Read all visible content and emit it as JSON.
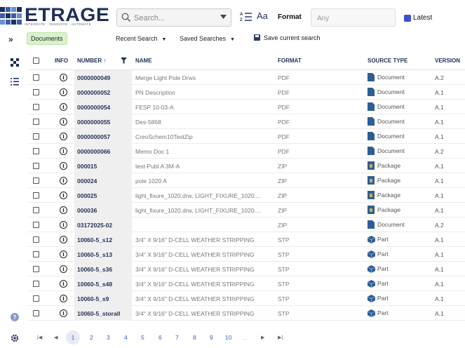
{
  "logo": {
    "name": "ETRAGE",
    "tagline": "INTEGRATE · INNOVATE · AUTOMATE",
    "colors": [
      "#1f2f5a",
      "#3a5ea8",
      "#6a8fd0"
    ]
  },
  "search": {
    "placeholder": "Search...",
    "icon": "search-icon"
  },
  "format_filter": {
    "label": "Format",
    "placeholder": "Any",
    "sort_icon": "sort-az-icon",
    "font_icon": "font-size-icon",
    "font_icon_text": "Aa"
  },
  "latest": {
    "label": "Latest",
    "color": "#3a52d0"
  },
  "toolbar": {
    "expand_icon": "double-chevron-right-icon",
    "documents_label": "Documents",
    "recent_search_label": "Recent Search",
    "saved_searches_label": "Saved Searches",
    "save_current_search_label": "Save current search"
  },
  "rail": {
    "icons": [
      "tree-icon",
      "list-icon",
      "help-icon",
      "settings-icon"
    ]
  },
  "columns": {
    "info": "INFO",
    "number": "NUMBER ↑",
    "name": "NAME",
    "format": "FORMAT",
    "source_type": "SOURCE TYPE",
    "version": "VERSION"
  },
  "rows": [
    {
      "number": "0000000049",
      "name": "Merge Light Pole Drws",
      "format": "PDF",
      "source_type": "Document",
      "source_icon": "document-icon",
      "version": "A.2"
    },
    {
      "number": "0000000052",
      "name": "PN Description",
      "format": "PDF",
      "source_type": "Document",
      "source_icon": "document-icon",
      "version": "A.1"
    },
    {
      "number": "0000000054",
      "name": "FESP 10-03-A",
      "format": "PDF",
      "source_type": "Document",
      "source_icon": "document-icon",
      "version": "A.1"
    },
    {
      "number": "0000000055",
      "name": "Des-5868",
      "format": "PDF",
      "source_type": "Document",
      "source_icon": "document-icon",
      "version": "A.1"
    },
    {
      "number": "0000000057",
      "name": "CreoSchem10TestZip",
      "format": "PDF",
      "source_type": "Document",
      "source_icon": "document-icon",
      "version": "A.1"
    },
    {
      "number": "0000000066",
      "name": "Memo Doc 1",
      "format": "PDF",
      "source_type": "Document",
      "source_icon": "document-icon",
      "version": "A.2"
    },
    {
      "number": "000015",
      "name": "test-Publ A 3M-A",
      "format": "ZIP",
      "source_type": "Package",
      "source_icon": "package-icon",
      "version": "A.1"
    },
    {
      "number": "000024",
      "name": "pole 1020 A",
      "format": "ZIP",
      "source_type": "Package",
      "source_icon": "package-icon",
      "version": "A.1"
    },
    {
      "number": "000025",
      "name": "light_fixure_1020.drw, LIGHT_FIXURE_1020....",
      "format": "ZIP",
      "source_type": "Package",
      "source_icon": "package-icon",
      "version": "A.1"
    },
    {
      "number": "000036",
      "name": "light_fixure_1020.drw, LIGHT_FIXURE_1020....",
      "format": "ZIP",
      "source_type": "Package",
      "source_icon": "package-icon",
      "version": "A.1"
    },
    {
      "number": "03172025-02",
      "name": "",
      "format": "ZIP",
      "source_type": "Document",
      "source_icon": "document-icon",
      "version": "A.2"
    },
    {
      "number": "10060-5_s12",
      "name": "3/4\" X 9/16\" D-CELL WEATHER STRIPPING",
      "format": "STP",
      "source_type": "Part",
      "source_icon": "part-icon",
      "version": "A.1"
    },
    {
      "number": "10060-5_s13",
      "name": "3/4\" X 9/16\" D-CELL WEATHER STRIPPING",
      "format": "STP",
      "source_type": "Part",
      "source_icon": "part-icon",
      "version": "A.1"
    },
    {
      "number": "10060-5_s36",
      "name": "3/4\" X 9/16\" D-CELL WEATHER STRIPPING",
      "format": "STP",
      "source_type": "Part",
      "source_icon": "part-icon",
      "version": "A.1"
    },
    {
      "number": "10060-5_s48",
      "name": "3/4\" X 9/16\" D-CELL WEATHER STRIPPING",
      "format": "STP",
      "source_type": "Part",
      "source_icon": "part-icon",
      "version": "A.1"
    },
    {
      "number": "10060-5_s9",
      "name": "3/4\" X 9/16\" D-CELL WEATHER STRIPPING",
      "format": "STP",
      "source_type": "Part",
      "source_icon": "part-icon",
      "version": "A.1"
    },
    {
      "number": "10060-5_storall",
      "name": "3/4\" X 9/16\" D-CELL WEATHER STRIPPING",
      "format": "STP",
      "source_type": "Part",
      "source_icon": "part-icon",
      "version": "A.1"
    }
  ],
  "pagination": {
    "first": "first-page-icon",
    "prev": "prev-page-icon",
    "pages": [
      "1",
      "2",
      "3",
      "4",
      "5",
      "6",
      "7",
      "8",
      "9",
      "10"
    ],
    "active_page": "1",
    "ellipsis": "...",
    "next": "next-page-icon",
    "last": "last-page-icon"
  }
}
